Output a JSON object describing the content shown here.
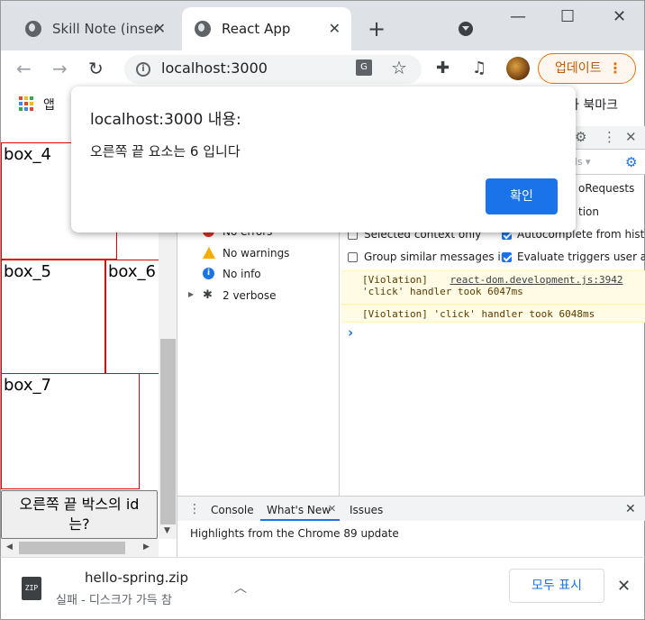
{
  "tabs": [
    {
      "title": "Skill Note (inser",
      "active": false
    },
    {
      "title": "React App",
      "active": true
    }
  ],
  "window_controls": {
    "minimize": "—",
    "maximize": "☐",
    "close": "✕"
  },
  "toolbar": {
    "url": "localhost:3000",
    "update_label": "업데이트",
    "update_menu": "⋮"
  },
  "bookmarks": {
    "apps_label": "앱",
    "bookmarks_label": "타 북마크"
  },
  "page": {
    "boxes": [
      "box_4",
      "box_5",
      "box_6",
      "box_7"
    ],
    "button_label_line1": "오른쪽 끝 박스의 id",
    "button_label_line2": "는?"
  },
  "alert": {
    "title": "localhost:3000 내용:",
    "message": "오른쪽 끝 요소는 6 입니다",
    "ok_label": "확인"
  },
  "devtools": {
    "sidebar": [
      {
        "label": "No errors",
        "icon": "error-icon",
        "color": "#d93025"
      },
      {
        "label": "No warnings",
        "icon": "warning-icon",
        "color": "#f9ab00"
      },
      {
        "label": "No info",
        "icon": "info-icon",
        "color": "#1a73e8"
      },
      {
        "label": "2 verbose",
        "icon": "bug-icon",
        "color": "#3c4043"
      }
    ],
    "filter_partial": "els ▾",
    "settings_partial": [
      {
        "label": "oRequests"
      },
      {
        "label": "tion"
      },
      {
        "label": "Selected context only",
        "checked": false
      },
      {
        "label": "Autocomplete from history",
        "checked": true
      },
      {
        "label": "Group similar messages in",
        "checked": false
      },
      {
        "label": "Evaluate triggers user activ",
        "checked": true
      }
    ],
    "messages": [
      {
        "tag": "[Violation]",
        "link": "react-dom.development.js:3942",
        "text": "'click' handler took 6047ms"
      },
      {
        "text": "[Violation] 'click' handler took 6048ms"
      }
    ],
    "prompt": "›",
    "drawer_tabs": [
      "Console",
      "What's New",
      "Issues"
    ],
    "drawer_highlight": "Highlights from the Chrome 89 update"
  },
  "download": {
    "filename": "hello-spring.zip",
    "status": "실패 - 디스크가 가득 참",
    "show_all_label": "모두 표시",
    "icon_label": "ZIP"
  },
  "colors": {
    "accent": "#1a73e8",
    "box_border": "#e00000",
    "update_orange": "#e8710a"
  }
}
